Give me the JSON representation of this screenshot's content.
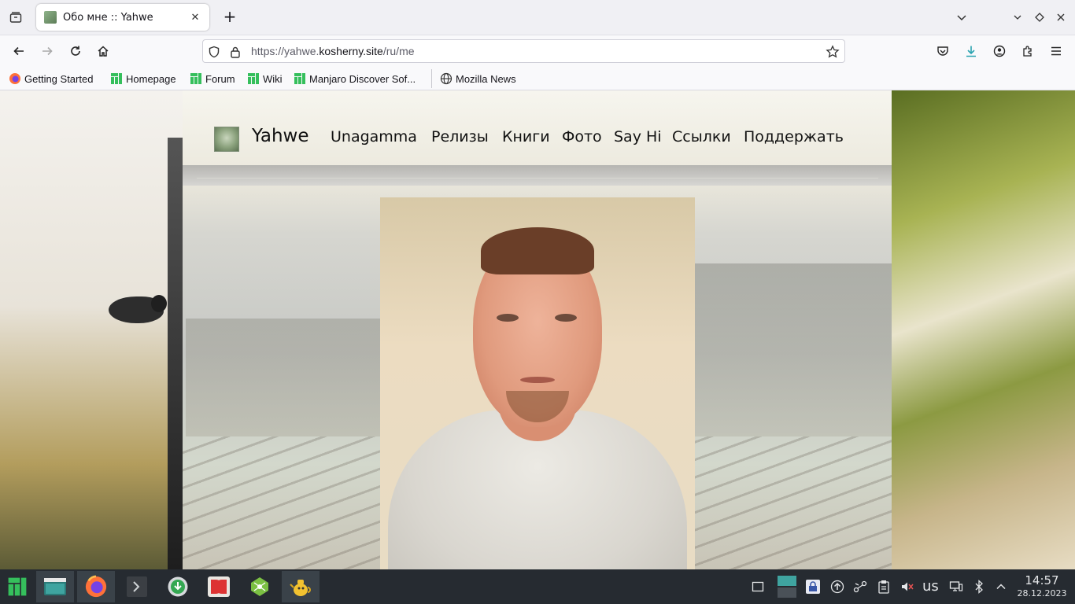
{
  "browser": {
    "tab": {
      "title": "Обо мне :: Yahwe",
      "close": "✕"
    },
    "new_tab": "+",
    "url": {
      "prefix": "https://yahwe.",
      "domain": "kosherny.site",
      "path": "/ru/me"
    },
    "bookmarks": [
      {
        "label": "Getting Started",
        "icon": "firefox-icon"
      },
      {
        "label": "Homepage",
        "icon": "manjaro-icon"
      },
      {
        "label": "Forum",
        "icon": "manjaro-icon"
      },
      {
        "label": "Wiki",
        "icon": "manjaro-icon"
      },
      {
        "label": "Manjaro Discover Sof...",
        "icon": "manjaro-icon"
      },
      {
        "label": "Mozilla News",
        "icon": "globe-icon"
      }
    ]
  },
  "site": {
    "name": "Yahwe",
    "menu": [
      "Unagamma",
      "Релизы",
      "Книги",
      "Фото",
      "Say Hi",
      "Ссылки",
      "Поддержать"
    ]
  },
  "taskbar": {
    "keyboard_layout": "us",
    "time": "14:57",
    "date": "28.12.2023"
  },
  "colors": {
    "taskbar": "#262b31",
    "manjaro_green": "#35bf5c",
    "download_accent": "#2aa3b0"
  }
}
